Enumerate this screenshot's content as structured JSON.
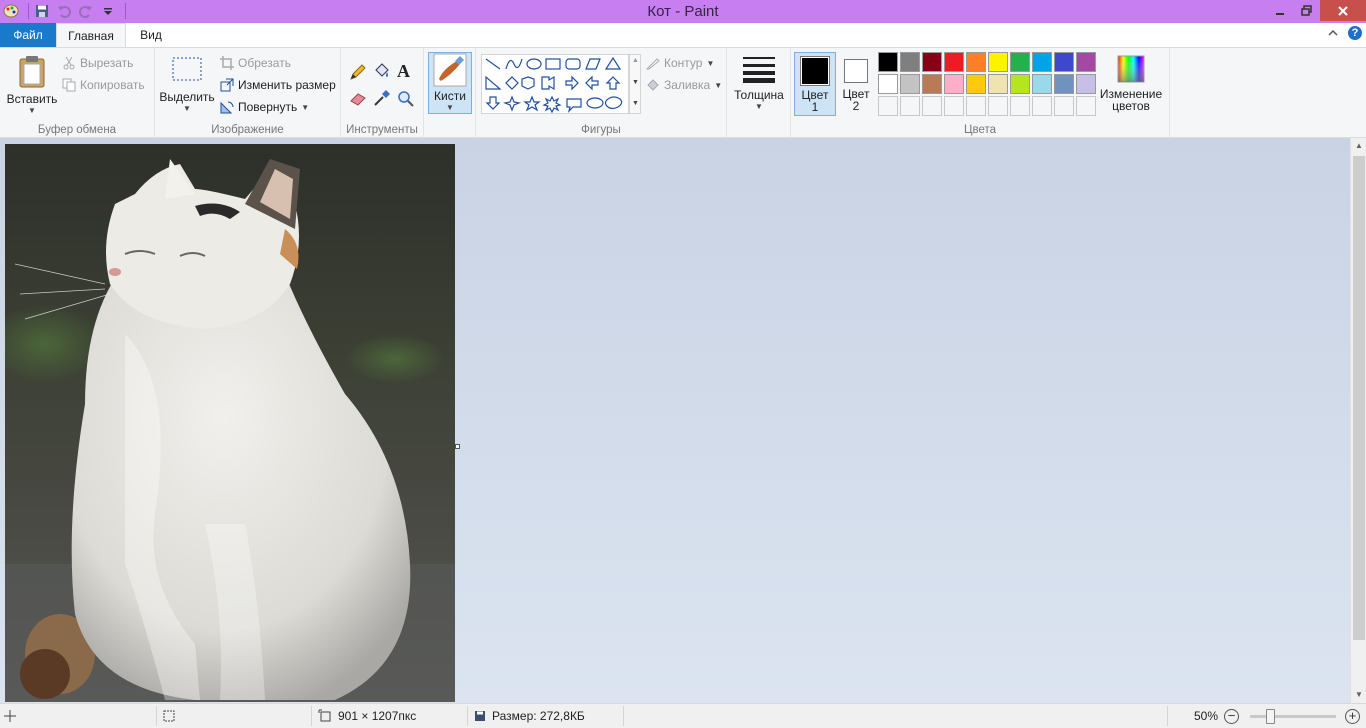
{
  "window": {
    "title": "Кот - Paint"
  },
  "tabs": {
    "file": "Файл",
    "home": "Главная",
    "view": "Вид"
  },
  "clipboard": {
    "paste": "Вставить",
    "cut": "Вырезать",
    "copy": "Копировать",
    "label": "Буфер обмена"
  },
  "image": {
    "select": "Выделить",
    "crop": "Обрезать",
    "resize": "Изменить размер",
    "rotate": "Повернуть",
    "label": "Изображение"
  },
  "tools": {
    "label": "Инструменты"
  },
  "brushes": {
    "label": "Кисти"
  },
  "shapes": {
    "outline": "Контур",
    "fill": "Заливка",
    "label": "Фигуры"
  },
  "size": {
    "label": "Толщина"
  },
  "colors": {
    "color1_label": "Цвет",
    "color1_num": "1",
    "color2_label": "Цвет",
    "color2_num": "2",
    "edit_label": "Изменение",
    "edit_label2": "цветов",
    "label": "Цвета",
    "color1": "#000000",
    "color2": "#ffffff",
    "row1": [
      "#000000",
      "#7f7f7f",
      "#880015",
      "#ed1c24",
      "#ff7f27",
      "#fff200",
      "#22b14c",
      "#00a2e8",
      "#3f48cc",
      "#a349a4"
    ],
    "row2": [
      "#ffffff",
      "#c3c3c3",
      "#b97a57",
      "#ffaec9",
      "#ffc90e",
      "#efe4b0",
      "#b5e61d",
      "#99d9ea",
      "#7092be",
      "#c8bfe7"
    ]
  },
  "status": {
    "dimensions": "901 × 1207пкс",
    "filesize": "Размер: 272,8КБ",
    "zoom": "50%"
  }
}
